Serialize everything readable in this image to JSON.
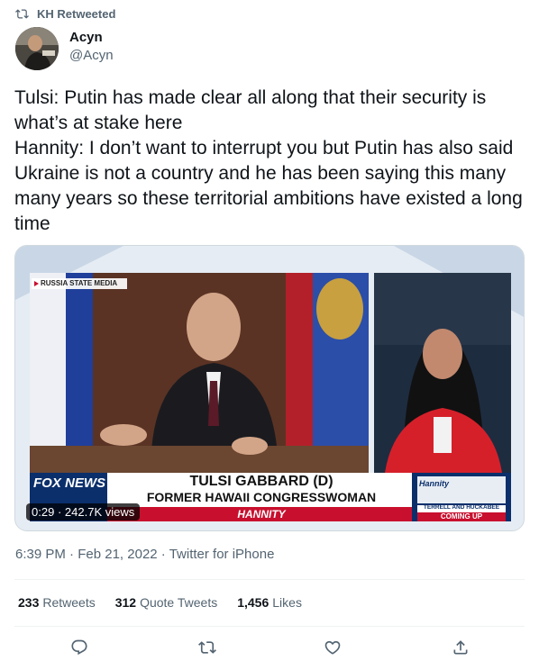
{
  "retweet_label": "KH Retweeted",
  "author": {
    "name": "Acyn",
    "handle": "@Acyn"
  },
  "tweet": {
    "lines": [
      "Tulsi: Putin has made clear all along that their security is what’s at stake here",
      "Hannity: I don’t want to interrupt you but Putin has also said Ukraine is not a country and he has been saying this many many years so these territorial ambitions have existed a long time"
    ]
  },
  "video": {
    "overlay_label": "RUSSIA STATE MEDIA",
    "chyron_name": "TULSI GABBARD (D)",
    "chyron_title": "FORMER HAWAII CONGRESSWOMAN",
    "show_name": "HANNITY",
    "network": "FOX NEWS",
    "promo_show": "Hannity",
    "promo_text": "TERRELL AND HUCKABEE",
    "promo_coming": "COMING UP",
    "duration": "0:29",
    "views": "242.7K views"
  },
  "meta": {
    "time": "6:39 PM",
    "date": "Feb 21, 2022",
    "source": "Twitter for iPhone",
    "separator": "·"
  },
  "stats": {
    "retweets_count": "233",
    "retweets_label": "Retweets",
    "quotes_count": "312",
    "quotes_label": "Quote Tweets",
    "likes_count": "1,456",
    "likes_label": "Likes"
  },
  "icons": {
    "retweet_header": "retweet-icon",
    "reply": "reply-icon",
    "retweet": "retweet-icon",
    "like": "heart-icon",
    "share": "share-icon"
  },
  "colors": {
    "text": "#0f1419",
    "secondary": "#536471",
    "border": "#eff3f4",
    "fox_blue": "#0a2f6b",
    "red": "#c8102e"
  }
}
